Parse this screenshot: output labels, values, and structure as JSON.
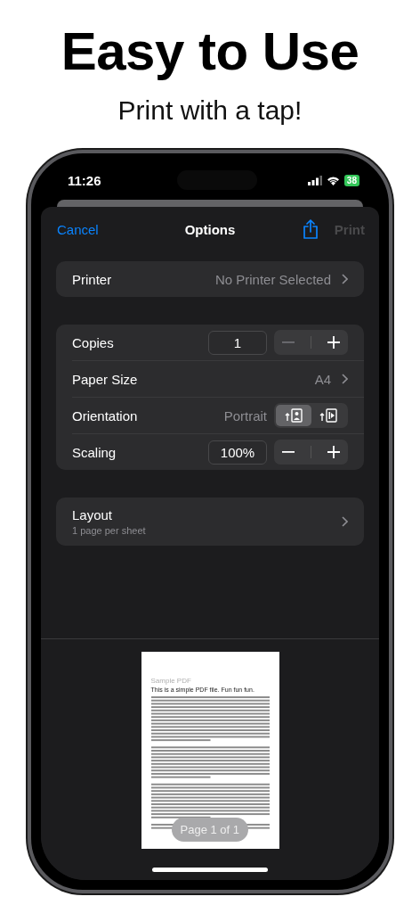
{
  "headline": "Easy to Use",
  "subheadline": "Print with a tap!",
  "status_bar": {
    "time": "11:26",
    "battery": "38"
  },
  "nav": {
    "cancel": "Cancel",
    "title": "Options",
    "print": "Print",
    "print_disabled": true
  },
  "printer": {
    "label": "Printer",
    "value": "No Printer Selected"
  },
  "settings": [
    {
      "kind": "stepper",
      "label": "Copies",
      "value": "1",
      "minus_disabled": true
    },
    {
      "kind": "link",
      "label": "Paper Size",
      "value": "A4"
    },
    {
      "kind": "orientation",
      "label": "Orientation",
      "value": "Portrait",
      "options": [
        {
          "kind": "portrait",
          "selected": true
        },
        {
          "kind": "landscape",
          "selected": false
        }
      ]
    },
    {
      "kind": "stepper",
      "label": "Scaling",
      "value": "100%",
      "minus_disabled": false
    }
  ],
  "layout": {
    "label": "Layout",
    "detail": "1 page per sheet"
  },
  "preview": {
    "doc_title": "Sample PDF",
    "doc_subtitle": "This is a simple PDF file. Fun fun fun.",
    "page_label": "Page 1 of 1"
  }
}
